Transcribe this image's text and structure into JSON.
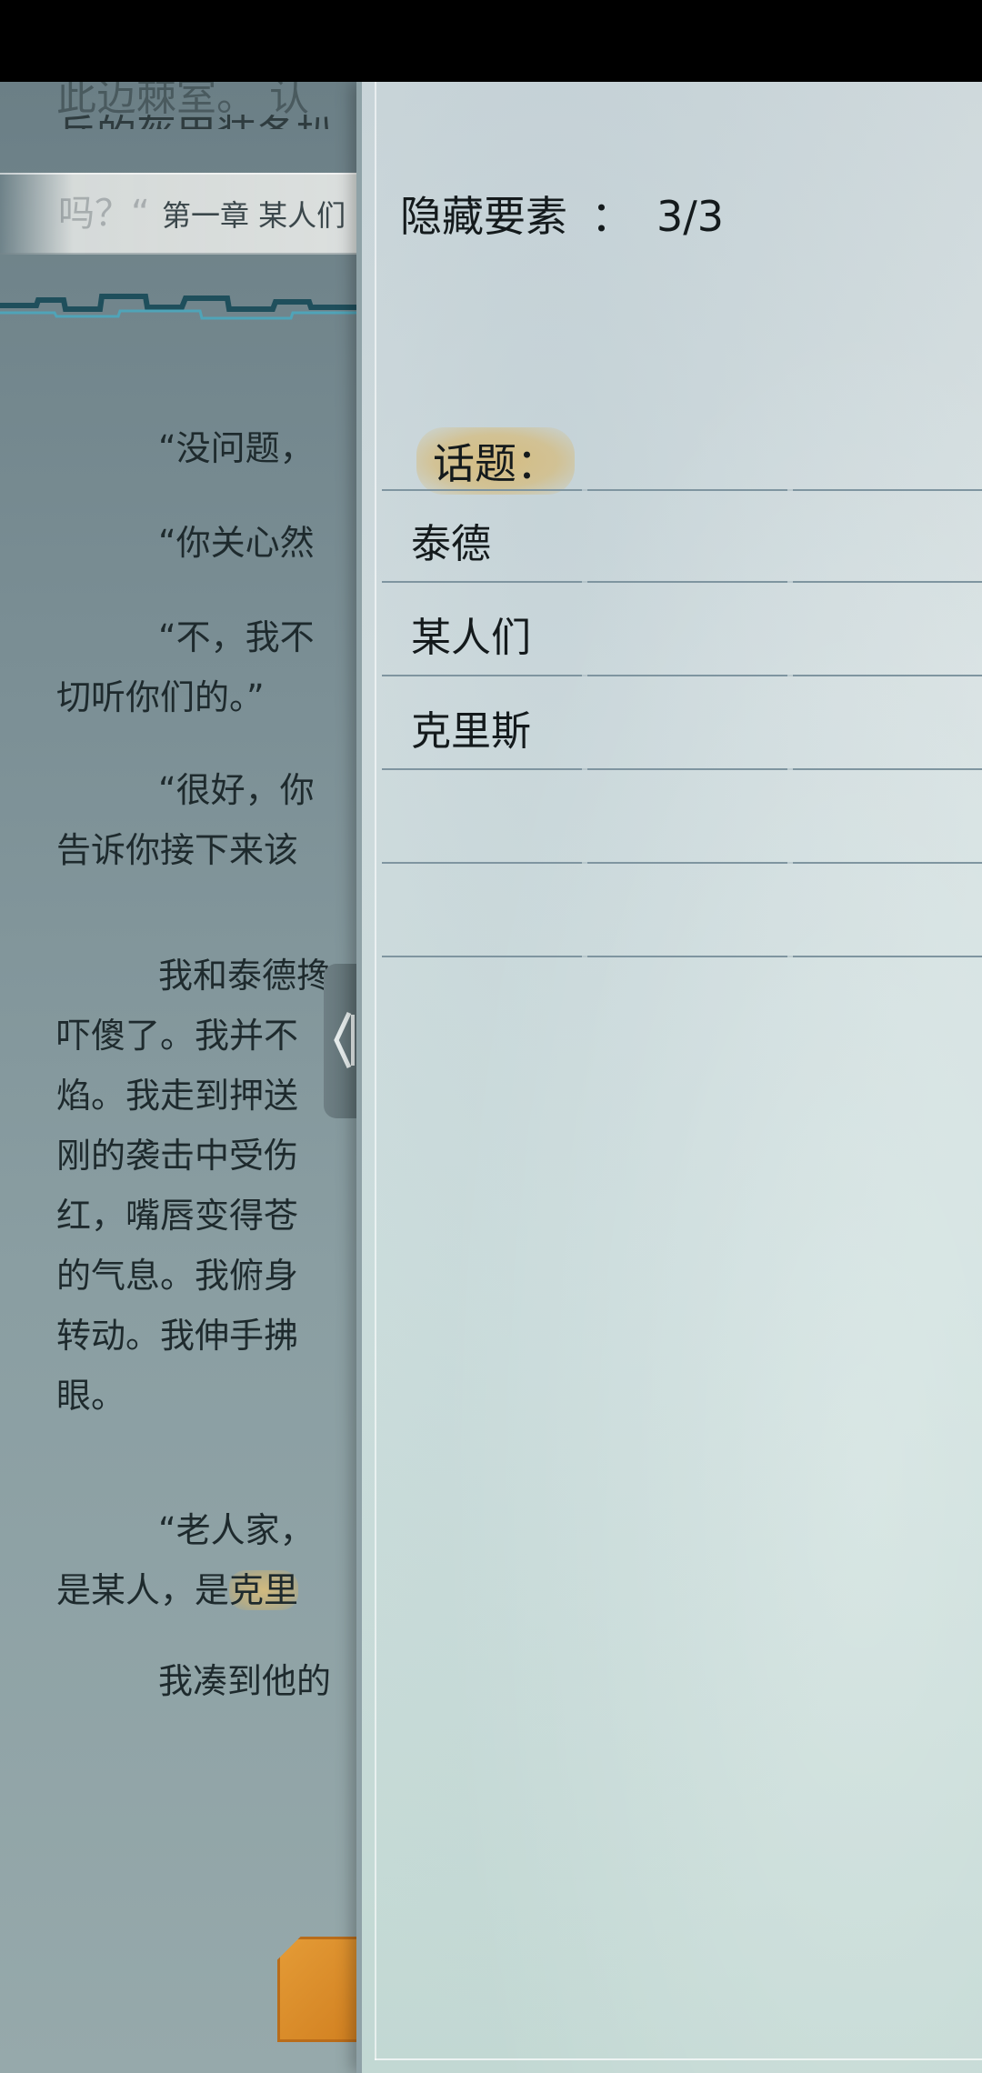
{
  "reader": {
    "top_lines": [
      "此迈棘室。  认",
      "兵的盔甲装备扒"
    ],
    "chapter_ghost": "吗？“",
    "chapter_title": "第一章  某人们",
    "paragraphs": [
      {
        "lines": [
          "“没问题，"
        ],
        "indent": true
      },
      {
        "lines": [
          "“你关心然"
        ],
        "indent": true
      },
      {
        "lines": [
          "“不，我不",
          "切听你们的。”"
        ],
        "indent": true
      },
      {
        "lines": [
          "“很好，你",
          "告诉你接下来该"
        ],
        "indent": true
      },
      {
        "lines": [
          "我和泰德搀",
          "吓傻了。我并不",
          "焰。我走到押送",
          "刚的袭击中受伤",
          "红，嘴唇变得苍",
          "的气息。我俯身",
          "转动。我伸手拂",
          "眼。"
        ],
        "indent": true
      },
      {
        "lines": [
          "“老人家，",
          "是某人，是克里"
        ],
        "indent": true
      },
      {
        "lines": [
          "我凑到他的"
        ],
        "indent": true
      }
    ],
    "highlight_word": "克里"
  },
  "panel": {
    "title_label": "隐藏要素",
    "title_sep": "：",
    "title_count": "3/3",
    "section_label": "话题：",
    "topics": [
      "泰德",
      "某人们",
      "克里斯",
      "",
      ""
    ]
  },
  "icons": {
    "handle": "chevron-left-icon",
    "orange_button": "octagon-button-icon"
  },
  "colors": {
    "highlight": "#d6ba78",
    "accent_orange": "#e49b36"
  }
}
